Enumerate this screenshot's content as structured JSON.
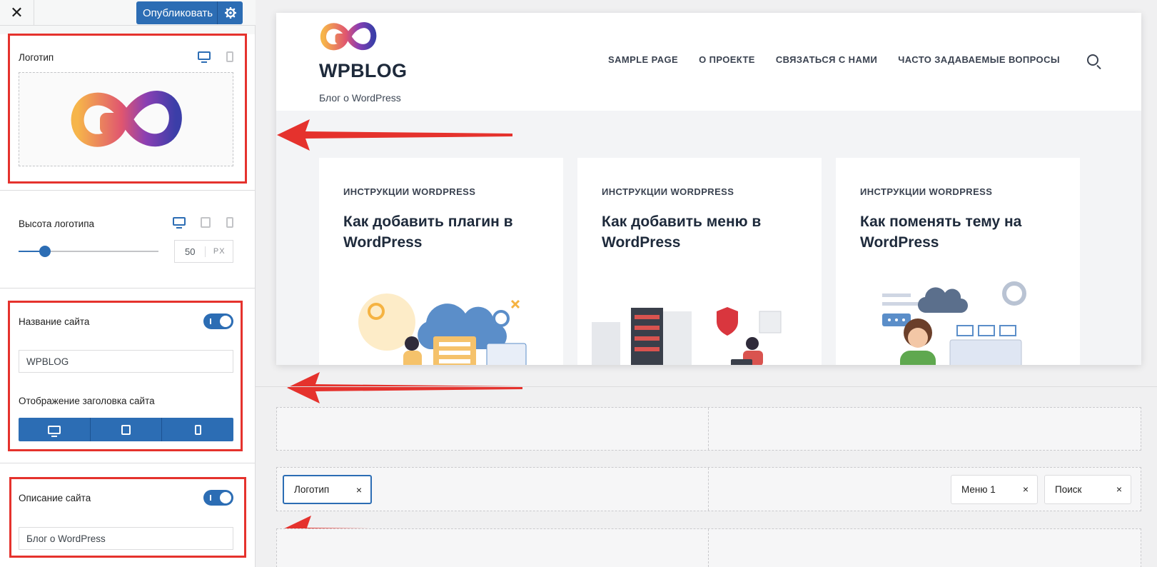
{
  "toolbar": {
    "close_label": "✕",
    "publish_label": "Опубликовать"
  },
  "logo_section": {
    "label": "Логотип"
  },
  "logo_height": {
    "label": "Высота логотипа",
    "value": "50",
    "unit": "PX",
    "slider_fraction": 0.19
  },
  "site_title_section": {
    "label": "Название сайта",
    "toggle_on": true,
    "input_value": "WPBLOG",
    "display_label": "Отображение заголовка сайта"
  },
  "site_desc_section": {
    "label": "Описание сайта",
    "toggle_on": true,
    "input_value": "Блог о WordPress"
  },
  "preview": {
    "site_title": "WPBLOG",
    "site_description": "Блог о WordPress",
    "nav": [
      "SAMPLE PAGE",
      "О ПРОЕКТЕ",
      "СВЯЗАТЬСЯ С НАМИ",
      "ЧАСТО ЗАДАВАЕМЫЕ ВОПРОСЫ"
    ],
    "cards": [
      {
        "category": "ИНСТРУКЦИИ WORDPRESS",
        "title": "Как добавить плагин в WordPress"
      },
      {
        "category": "ИНСТРУКЦИИ WORDPRESS",
        "title": "Как добавить меню в WordPress"
      },
      {
        "category": "ИНСТРУКЦИИ WORDPRESS",
        "title": "Как поменять тему на WordPress"
      }
    ]
  },
  "builder": {
    "chips": {
      "logo": "Логотип",
      "menu": "Меню 1",
      "search": "Поиск",
      "remove": "×"
    }
  },
  "colors": {
    "accent": "#2c6db4",
    "highlight": "#e5322d"
  },
  "icons": {
    "close": "close-icon",
    "settings": "gear-icon",
    "desktop": "desktop-icon",
    "tablet": "tablet-icon",
    "mobile": "mobile-icon",
    "search": "search-icon"
  }
}
